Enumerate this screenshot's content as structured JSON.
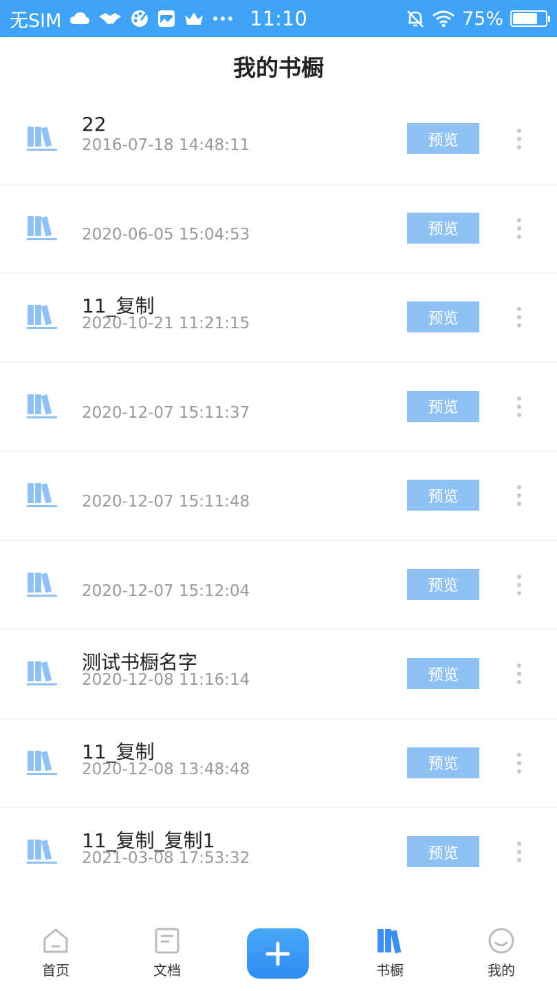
{
  "status_bar": {
    "carrier": "无SIM",
    "time": "11:10",
    "battery_text": "75%",
    "battery_level": 0.75,
    "icons": [
      "cloud-icon",
      "handshake-icon",
      "palette-icon",
      "vivo-icon",
      "crown-icon",
      "more-dots-icon",
      "alarm-off-icon",
      "wifi-icon",
      "battery-icon"
    ]
  },
  "header": {
    "title": "我的书橱"
  },
  "colors": {
    "accent": "#3fa3f5",
    "button": "#8ec2f5",
    "icon": "#8ec2f5"
  },
  "list": {
    "preview_label": "预览",
    "items": [
      {
        "name": "22",
        "date": "2016-07-18 14:48:11"
      },
      {
        "name": "",
        "date": "2020-06-05 15:04:53"
      },
      {
        "name": "11_复制",
        "date": "2020-10-21 11:21:15"
      },
      {
        "name": "",
        "date": "2020-12-07 15:11:37"
      },
      {
        "name": "",
        "date": "2020-12-07 15:11:48"
      },
      {
        "name": "",
        "date": "2020-12-07 15:12:04"
      },
      {
        "name": "测试书橱名字",
        "date": "2020-12-08 11:16:14"
      },
      {
        "name": "11_复制",
        "date": "2020-12-08 13:48:48"
      },
      {
        "name": "11_复制_复制1",
        "date": "2021-03-08 17:53:32"
      }
    ]
  },
  "tabbar": {
    "tabs": [
      {
        "label": "首页",
        "icon": "home-icon",
        "active": false
      },
      {
        "label": "文档",
        "icon": "document-icon",
        "active": false
      },
      {
        "label": "书橱",
        "icon": "bookshelf-icon",
        "active": true
      },
      {
        "label": "我的",
        "icon": "smiley-icon",
        "active": false
      }
    ],
    "add_icon": "plus-icon"
  }
}
